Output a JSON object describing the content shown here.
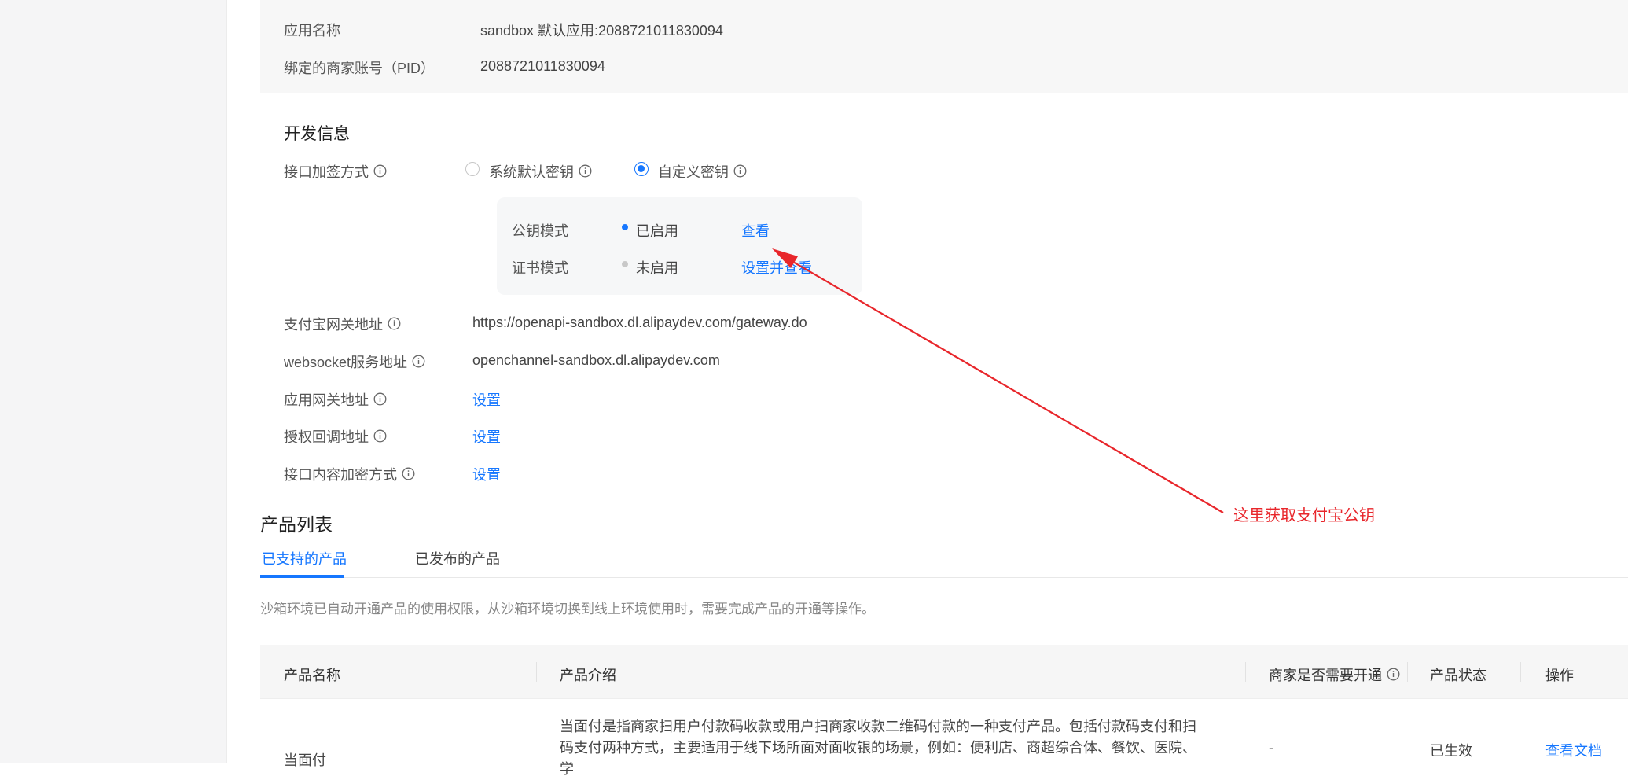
{
  "basic_info": {
    "app_name_label": "应用名称",
    "app_name_value": "sandbox 默认应用:2088721011830094",
    "pid_label": "绑定的商家账号（PID）",
    "pid_value": "2088721011830094"
  },
  "dev_info": {
    "title": "开发信息",
    "sign_method_label": "接口加签方式",
    "options": [
      {
        "label": "系统默认密钥",
        "selected": false
      },
      {
        "label": "自定义密钥",
        "selected": true
      }
    ],
    "key_modes": [
      {
        "label": "公钥模式",
        "status": "已启用",
        "status_color": "#1677ff",
        "action": "查看"
      },
      {
        "label": "证书模式",
        "status": "未启用",
        "status_color": "#c8c8c8",
        "action": "设置并查看"
      }
    ],
    "fields": [
      {
        "label": "支付宝网关地址",
        "value": "https://openapi-sandbox.dl.alipaydev.com/gateway.do"
      },
      {
        "label": "websocket服务地址",
        "value": "openchannel-sandbox.dl.alipaydev.com"
      },
      {
        "label": "应用网关地址",
        "link": "设置"
      },
      {
        "label": "授权回调地址",
        "link": "设置"
      },
      {
        "label": "接口内容加密方式",
        "link": "设置"
      }
    ]
  },
  "annotation": {
    "text": "这里获取支付宝公钥",
    "color": "#e8262b"
  },
  "products": {
    "title": "产品列表",
    "tabs": [
      {
        "label": "已支持的产品",
        "active": true
      },
      {
        "label": "已发布的产品",
        "active": false
      }
    ],
    "notice": "沙箱环境已自动开通产品的使用权限，从沙箱环境切换到线上环境使用时，需要完成产品的开通等操作。",
    "columns": [
      "产品名称",
      "产品介绍",
      "商家是否需要开通",
      "产品状态",
      "操作"
    ],
    "rows": [
      {
        "name": "当面付",
        "desc": "当面付是指商家扫用户付款码收款或用户扫商家收款二维码付款的一种支付产品。包括付款码支付和扫码支付两种方式，主要适用于线下场所面对面收银的场景，例如：便利店、商超综合体、餐饮、医院、学",
        "need_open": "-",
        "status": "已生效",
        "action": "查看文档"
      }
    ]
  },
  "colors": {
    "accent": "#1677ff",
    "annotation": "#e8262b"
  }
}
